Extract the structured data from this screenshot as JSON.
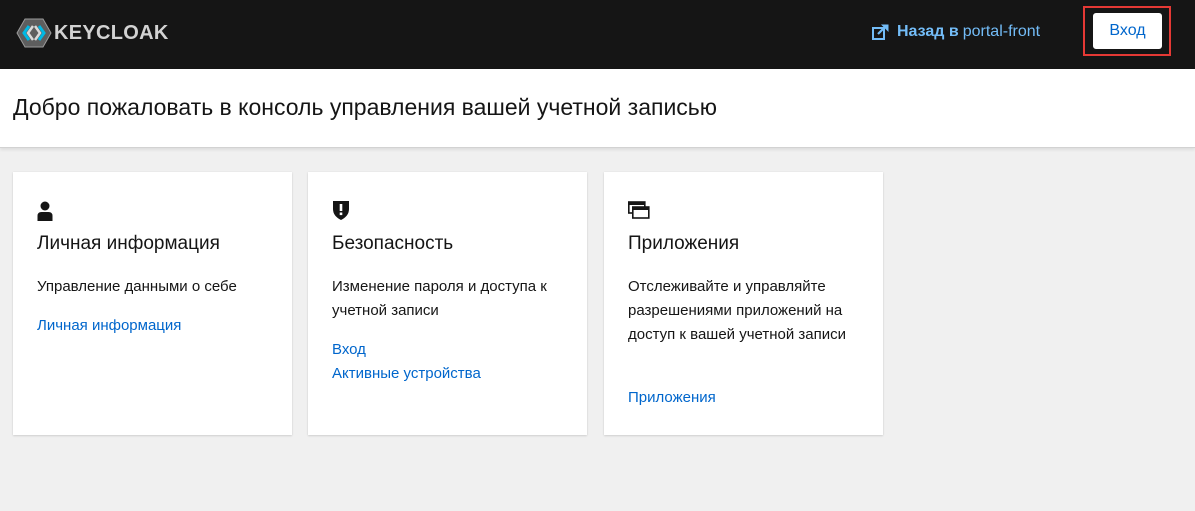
{
  "topbar": {
    "logo_text": "KEYCLOAK",
    "back_link_bold": "Назад в",
    "back_link_target": "portal-front",
    "login_label": "Вход"
  },
  "header": {
    "title": "Добро пожаловать в консоль управления вашей учетной записью"
  },
  "cards": [
    {
      "icon": "user-icon",
      "title": "Личная информация",
      "description": "Управление данными о себе",
      "links": [
        "Личная информация"
      ]
    },
    {
      "icon": "shield-icon",
      "title": "Безопасность",
      "description": "Изменение пароля и доступа к учетной записи",
      "links": [
        "Вход",
        "Активные устройства"
      ]
    },
    {
      "icon": "applications-icon",
      "title": "Приложения",
      "description": "Отслеживайте и управляйте разрешениями приложений на доступ к вашей учетной записи",
      "links": [
        "Приложения"
      ]
    }
  ],
  "colors": {
    "topbar_bg": "#151515",
    "link": "#0066cc",
    "back_link": "#73bcf7",
    "highlight_frame": "#e53935"
  }
}
